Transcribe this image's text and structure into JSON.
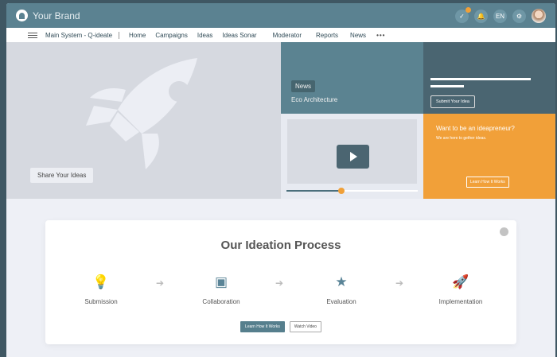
{
  "header": {
    "brand": "Your Brand",
    "lang": "EN"
  },
  "nav": {
    "system": "Main System - Q-ideate",
    "items": [
      "Home",
      "Campaigns",
      "Ideas",
      "Ideas Sonar",
      "Moderator",
      "Reports",
      "News"
    ],
    "more": "•••"
  },
  "hero": {
    "share_label": "Share Your Ideas",
    "news_tag": "News",
    "news_title": "Eco Architecture",
    "submit_label": "Submit Your Idea",
    "video_progress": 0.42,
    "promo": {
      "title": "Want to be an ideapreneur?",
      "subtitle": "We are here to gether ideas.",
      "button": "Learn How It Works"
    }
  },
  "process": {
    "title": "Our Ideation Process",
    "steps": [
      {
        "label": "Submission",
        "icon": "lightbulb-icon"
      },
      {
        "label": "Collaboration",
        "icon": "chat-icon"
      },
      {
        "label": "Evaluation",
        "icon": "star-icon"
      },
      {
        "label": "Implementation",
        "icon": "rocket-icon"
      }
    ],
    "learn_label": "Learn How It Works",
    "video_label": "Watch Video"
  },
  "colors": {
    "primary": "#5b8291",
    "accent": "#f1a039",
    "dark": "#4a6571"
  }
}
